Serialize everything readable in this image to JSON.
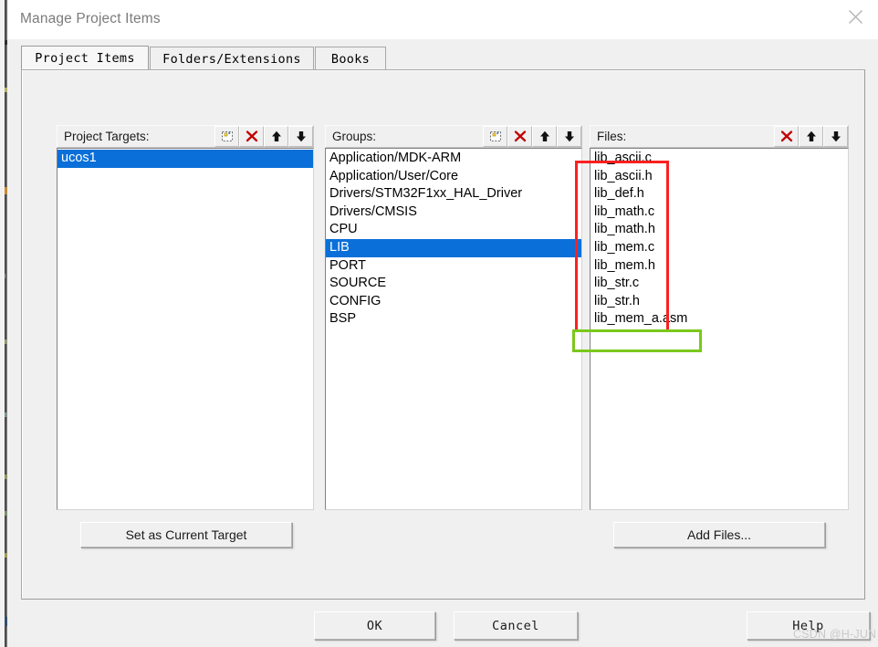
{
  "window": {
    "title": "Manage Project Items",
    "close_icon": "close-icon"
  },
  "tabs": [
    {
      "label": "Project Items",
      "active": true
    },
    {
      "label": "Folders/Extensions",
      "active": false
    },
    {
      "label": "Books",
      "active": false
    }
  ],
  "panels": {
    "targets": {
      "header_label": "Project Targets:",
      "buttons": [
        {
          "name": "new-target-button",
          "icon": "new-item-icon"
        },
        {
          "name": "delete-target-button",
          "icon": "delete-x-icon"
        },
        {
          "name": "move-target-up-button",
          "icon": "arrow-up-icon"
        },
        {
          "name": "move-target-down-button",
          "icon": "arrow-down-icon"
        }
      ],
      "items": [
        {
          "label": "ucos1",
          "selected": true
        }
      ]
    },
    "groups": {
      "header_label": "Groups:",
      "buttons": [
        {
          "name": "new-group-button",
          "icon": "new-item-icon"
        },
        {
          "name": "delete-group-button",
          "icon": "delete-x-icon"
        },
        {
          "name": "move-group-up-button",
          "icon": "arrow-up-icon"
        },
        {
          "name": "move-group-down-button",
          "icon": "arrow-down-icon"
        }
      ],
      "items": [
        {
          "label": "Application/MDK-ARM",
          "selected": false
        },
        {
          "label": "Application/User/Core",
          "selected": false
        },
        {
          "label": "Drivers/STM32F1xx_HAL_Driver",
          "selected": false
        },
        {
          "label": "Drivers/CMSIS",
          "selected": false
        },
        {
          "label": "CPU",
          "selected": false
        },
        {
          "label": "LIB",
          "selected": true
        },
        {
          "label": "PORT",
          "selected": false
        },
        {
          "label": "SOURCE",
          "selected": false
        },
        {
          "label": "CONFIG",
          "selected": false
        },
        {
          "label": "BSP",
          "selected": false
        }
      ]
    },
    "files": {
      "header_label": "Files:",
      "buttons": [
        {
          "name": "delete-file-button",
          "icon": "delete-x-icon"
        },
        {
          "name": "move-file-up-button",
          "icon": "arrow-up-icon"
        },
        {
          "name": "move-file-down-button",
          "icon": "arrow-down-icon"
        }
      ],
      "items": [
        {
          "label": "lib_ascii.c",
          "selected": false
        },
        {
          "label": "lib_ascii.h",
          "selected": false
        },
        {
          "label": "lib_def.h",
          "selected": false
        },
        {
          "label": "lib_math.c",
          "selected": false
        },
        {
          "label": "lib_math.h",
          "selected": false
        },
        {
          "label": "lib_mem.c",
          "selected": false
        },
        {
          "label": "lib_mem.h",
          "selected": false
        },
        {
          "label": "lib_str.c",
          "selected": false
        },
        {
          "label": "lib_str.h",
          "selected": false
        },
        {
          "label": "lib_mem_a.asm",
          "selected": false
        }
      ]
    }
  },
  "buttons": {
    "set_as_current_target": "Set as Current Target",
    "add_files": "Add Files...",
    "ok": "OK",
    "cancel": "Cancel",
    "help": "Help"
  },
  "annotations": [
    {
      "name": "red-highlight-box",
      "color": "#fb2020",
      "covers": "lib_ascii.c through lib_str.h"
    },
    {
      "name": "green-highlight-box",
      "color": "#7ac81b",
      "covers": "lib_mem_a.asm"
    }
  ],
  "watermark": {
    "text": "CSDN @H-JUN"
  },
  "colors": {
    "selection_blue": "#0a6fd8",
    "dialog_face": "#f0f0f0",
    "title_text": "#7b7b7b",
    "annot_red": "#fb2020",
    "annot_green": "#7ac81b"
  }
}
